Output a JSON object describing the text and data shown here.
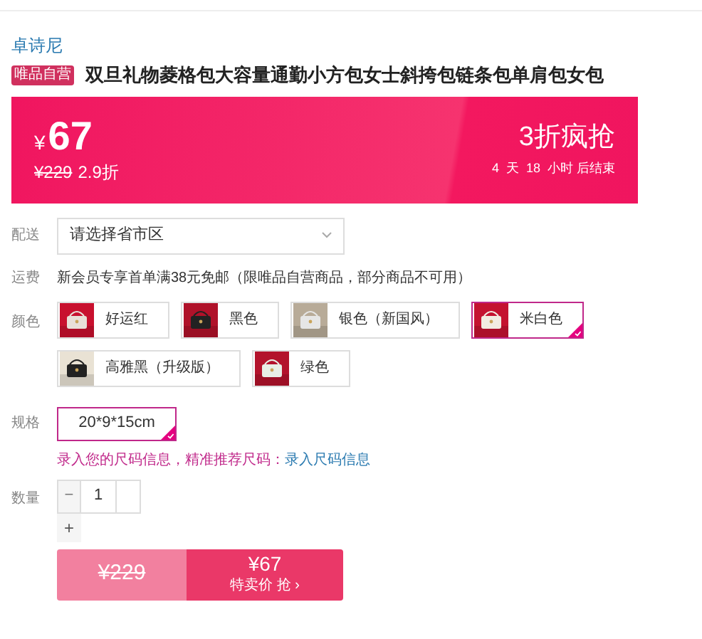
{
  "brand": "卓诗尼",
  "badge": "唯品自营",
  "title": "双旦礼物菱格包大容量通勤小方包女士斜挎包链条包单肩包女包",
  "promo": {
    "currency": "¥",
    "price": "67",
    "original": "¥229",
    "discount": "2.9折",
    "headline": "3折疯抢",
    "countdown": "4  天  18  小时 后结束"
  },
  "delivery": {
    "label": "配送",
    "value": "请选择省市区"
  },
  "shipping": {
    "label": "运费",
    "text": "新会员专享首单满38元免邮（限唯品自营商品，部分商品不可用）"
  },
  "colors": {
    "label": "颜色",
    "options": [
      {
        "name": "好运红",
        "selected": false
      },
      {
        "name": "黑色",
        "selected": false
      },
      {
        "name": "银色（新国风）",
        "selected": false
      },
      {
        "name": "米白色",
        "selected": true
      },
      {
        "name": "高雅黑（升级版）",
        "selected": false
      },
      {
        "name": "绿色",
        "selected": false
      }
    ]
  },
  "size": {
    "label": "规格",
    "options": [
      {
        "name": "20*9*15cm",
        "selected": true
      }
    ],
    "hint": "录入您的尺码信息，精准推荐尺码：",
    "hint_link": "录入尺码信息"
  },
  "quantity": {
    "label": "数量",
    "minus": "−",
    "value": "1",
    "plus": "+"
  },
  "buy": {
    "original": "¥229",
    "price": "¥67",
    "action": "特卖价 抢 ›"
  }
}
